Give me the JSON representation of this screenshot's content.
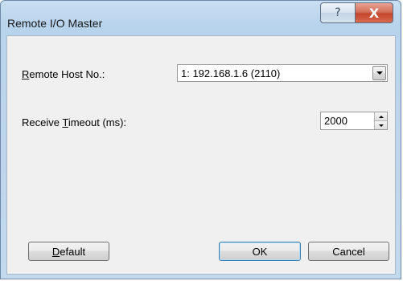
{
  "window": {
    "title": "Remote I/O Master",
    "help_glyph": "?",
    "close_glyph": "X"
  },
  "fields": {
    "remote_host": {
      "label_prefix": "",
      "label_accel": "R",
      "label_rest": "emote Host No.:",
      "value": "1: 192.168.1.6 (2110)"
    },
    "receive_timeout": {
      "label_prefix": "Receive ",
      "label_accel": "T",
      "label_rest": "imeout (ms):",
      "value": "2000"
    }
  },
  "buttons": {
    "default_accel": "D",
    "default_rest": "efault",
    "ok": "OK",
    "cancel": "Cancel"
  }
}
